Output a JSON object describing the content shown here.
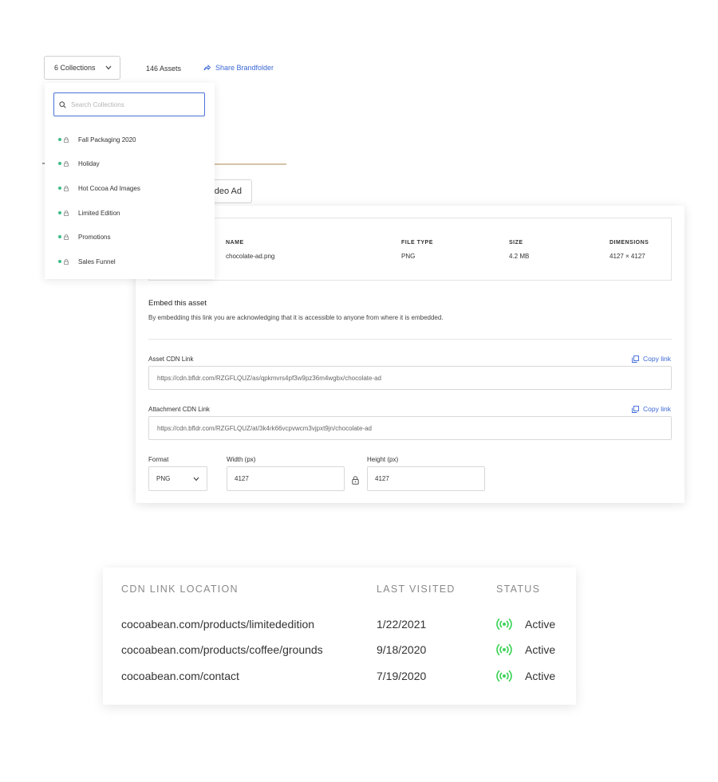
{
  "toolbar": {
    "collections_label": "6 Collections",
    "assets_count": "146 Assets",
    "share_label": "Share Brandfolder"
  },
  "background_tab": {
    "label": "ideo Ad"
  },
  "collections_dropdown": {
    "search_placeholder": "Search Collections",
    "items": [
      {
        "label": "Fall Packaging 2020"
      },
      {
        "label": "Holiday"
      },
      {
        "label": "Hot Cocoa Ad Images"
      },
      {
        "label": "Limited Edition"
      },
      {
        "label": "Promotions"
      },
      {
        "label": "Sales Funnel"
      }
    ]
  },
  "asset": {
    "name_header": "NAME",
    "name": "chocolate-ad.png",
    "file_type_header": "FILE TYPE",
    "file_type": "PNG",
    "size_header": "SIZE",
    "size": "4.2 MB",
    "dimensions_header": "DIMENSIONS",
    "dimensions": "4127 × 4127"
  },
  "embed": {
    "title": "Embed this asset",
    "description": "By embedding this link you are acknowledging that it is accessible to anyone from where it is embedded.",
    "asset_cdn_label": "Asset CDN Link",
    "asset_cdn_url": "https://cdn.bfldr.com/RZGFLQUZ/as/qpkmvrs4pf3w9pz36m4wgbx/chocolate-ad",
    "attachment_cdn_label": "Attachment CDN Link",
    "attachment_cdn_url": "https://cdn.bfldr.com/RZGFLQUZ/at/3k4rk66vcpvwcm3vjpxt9jn/chocolate-ad",
    "copy_link_label": "Copy link",
    "format_label": "Format",
    "format_value": "PNG",
    "width_label": "Width (px)",
    "width_value": "4127",
    "height_label": "Height (px)",
    "height_value": "4127"
  },
  "cdn_table": {
    "headers": {
      "location": "CDN LINK LOCATION",
      "last_visited": "LAST VISITED",
      "status": "STATUS"
    },
    "rows": [
      {
        "location": "cocoabean.com/products/limitededition",
        "last_visited": "1/22/2021",
        "status": "Active"
      },
      {
        "location": "cocoabean.com/products/coffee/grounds",
        "last_visited": "9/18/2020",
        "status": "Active"
      },
      {
        "location": "cocoabean.com/contact",
        "last_visited": "7/19/2020",
        "status": "Active"
      }
    ]
  },
  "colors": {
    "accent_blue": "#3b67d6",
    "status_green": "#3ed35a",
    "collection_dot": "#3dbd8a",
    "tab_underline": "#d5c4a6"
  }
}
